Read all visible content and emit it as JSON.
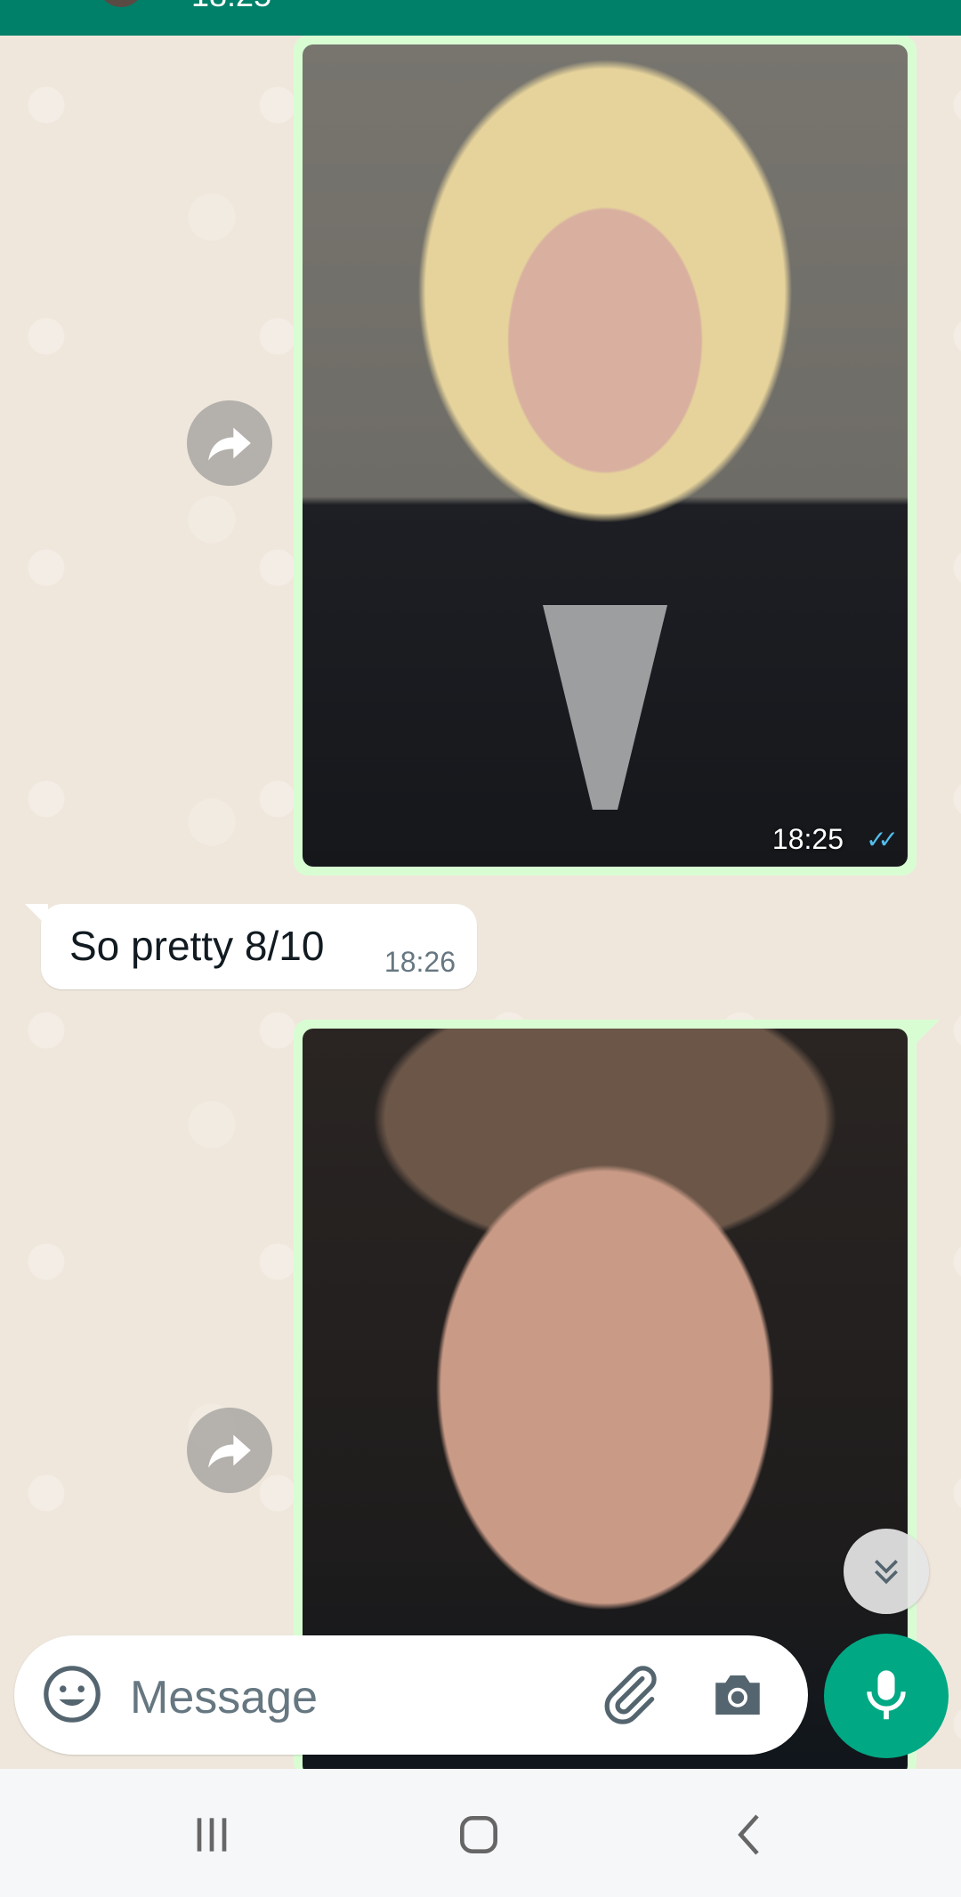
{
  "header": {
    "time_fragment": "18:25"
  },
  "messages": [
    {
      "type": "image",
      "direction": "outgoing",
      "time": "18:25",
      "status": "read",
      "subject": "blond long-haired man in black coat"
    },
    {
      "type": "text",
      "direction": "incoming",
      "text": "So pretty 8/10",
      "time": "18:26"
    },
    {
      "type": "image",
      "direction": "outgoing",
      "subject": "man with short brown hair, close-up"
    }
  ],
  "composer": {
    "placeholder": "Message"
  },
  "colors": {
    "header": "#008069",
    "outgoing_bubble": "#d9fdd3",
    "incoming_bubble": "#ffffff",
    "chat_background": "#efe7dc",
    "accent": "#00a884",
    "read_ticks": "#53bdeb"
  },
  "icons": {
    "forward": "forward-arrow-icon",
    "scroll_down": "double-chevron-down-icon",
    "emoji": "emoji-icon",
    "attach": "paperclip-icon",
    "camera": "camera-icon",
    "mic": "microphone-icon",
    "nav_recents": "recents-icon",
    "nav_home": "home-icon",
    "nav_back": "back-icon"
  }
}
